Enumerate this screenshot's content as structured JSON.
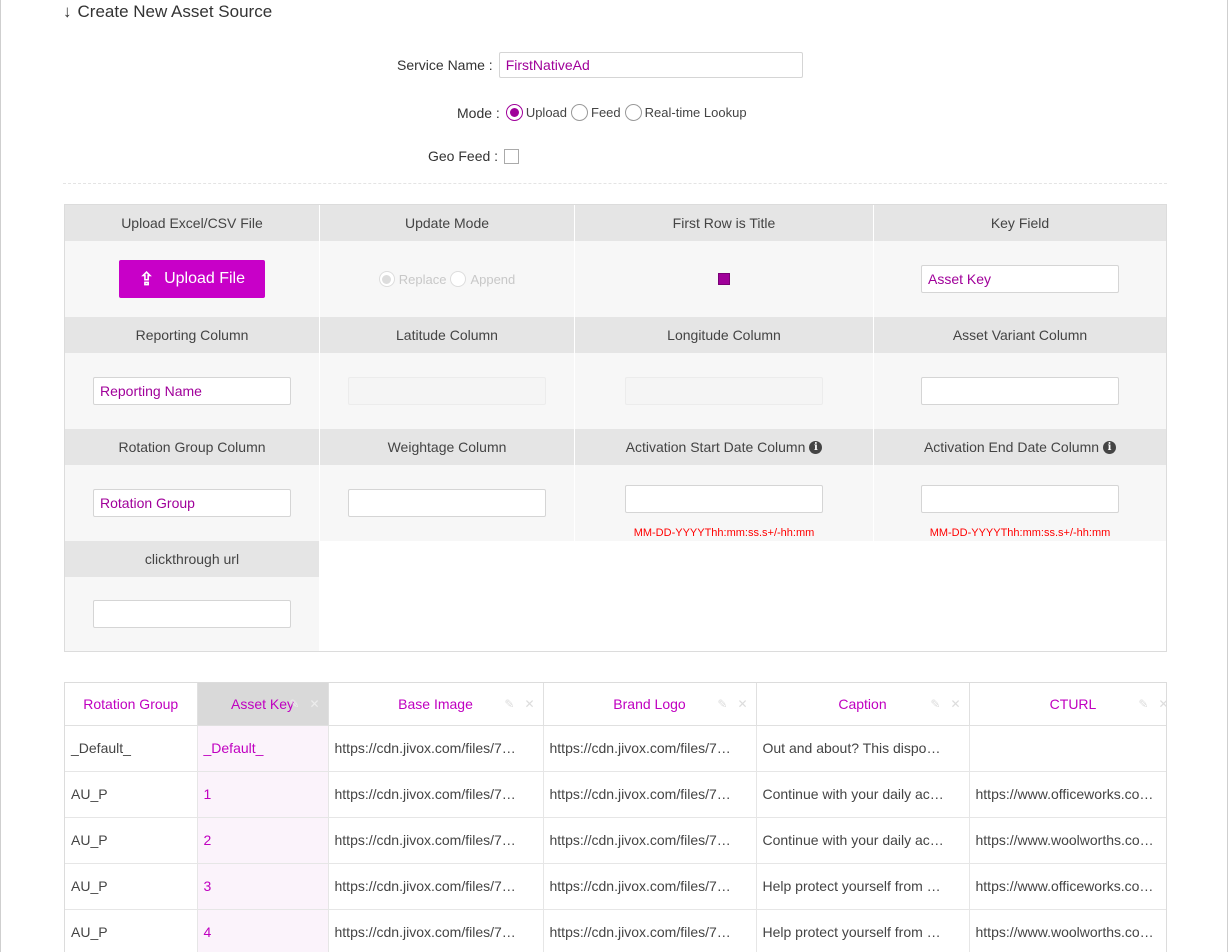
{
  "section": {
    "title": "Create New Asset Source"
  },
  "service": {
    "label": "Service Name :",
    "value": "FirstNativeAd"
  },
  "mode": {
    "label": "Mode :",
    "options": [
      "Upload",
      "Feed",
      "Real-time Lookup"
    ],
    "selected": "Upload"
  },
  "geo": {
    "label": "Geo Feed :",
    "checked": false
  },
  "grid": {
    "headers": {
      "upload": "Upload Excel/CSV File",
      "update_mode": "Update Mode",
      "first_row": "First Row is Title",
      "key_field": "Key Field",
      "reporting": "Reporting Column",
      "latitude": "Latitude Column",
      "longitude": "Longitude Column",
      "variant": "Asset Variant Column",
      "rotation": "Rotation Group Column",
      "weightage": "Weightage Column",
      "act_start": "Activation Start Date Column",
      "act_end": "Activation End Date Column",
      "clickthrough": "clickthrough url"
    },
    "upload_button": "Upload File",
    "update_options": [
      "Replace",
      "Append"
    ],
    "first_row_checked": true,
    "key_field_value": "Asset Key",
    "reporting_value": "Reporting Name",
    "rotation_value": "Rotation Group",
    "date_format_hint": "MM-DD-YYYYThh:mm:ss.s+/-hh:mm"
  },
  "table": {
    "columns": [
      "Rotation Group",
      "Asset Key",
      "Base Image",
      "Brand Logo",
      "Caption",
      "CTURL"
    ],
    "rows": [
      [
        "_Default_",
        "_Default_",
        "https://cdn.jivox.com/files/7…",
        "https://cdn.jivox.com/files/7…",
        "Out and about? This dispo…",
        ""
      ],
      [
        "AU_P",
        "1",
        "https://cdn.jivox.com/files/7…",
        "https://cdn.jivox.com/files/7…",
        "Continue with your daily ac…",
        "https://www.officeworks.co…"
      ],
      [
        "AU_P",
        "2",
        "https://cdn.jivox.com/files/7…",
        "https://cdn.jivox.com/files/7…",
        "Continue with your daily ac…",
        "https://www.woolworths.co…"
      ],
      [
        "AU_P",
        "3",
        "https://cdn.jivox.com/files/7…",
        "https://cdn.jivox.com/files/7…",
        "Help protect yourself from …",
        "https://www.officeworks.co…"
      ],
      [
        "AU_P",
        "4",
        "https://cdn.jivox.com/files/7…",
        "https://cdn.jivox.com/files/7…",
        "Help protect yourself from …",
        "https://www.woolworths.co…"
      ]
    ]
  },
  "colors": {
    "accent": "#c800c8",
    "text_accent": "#a0009a",
    "hint_red": "#ff0000"
  }
}
